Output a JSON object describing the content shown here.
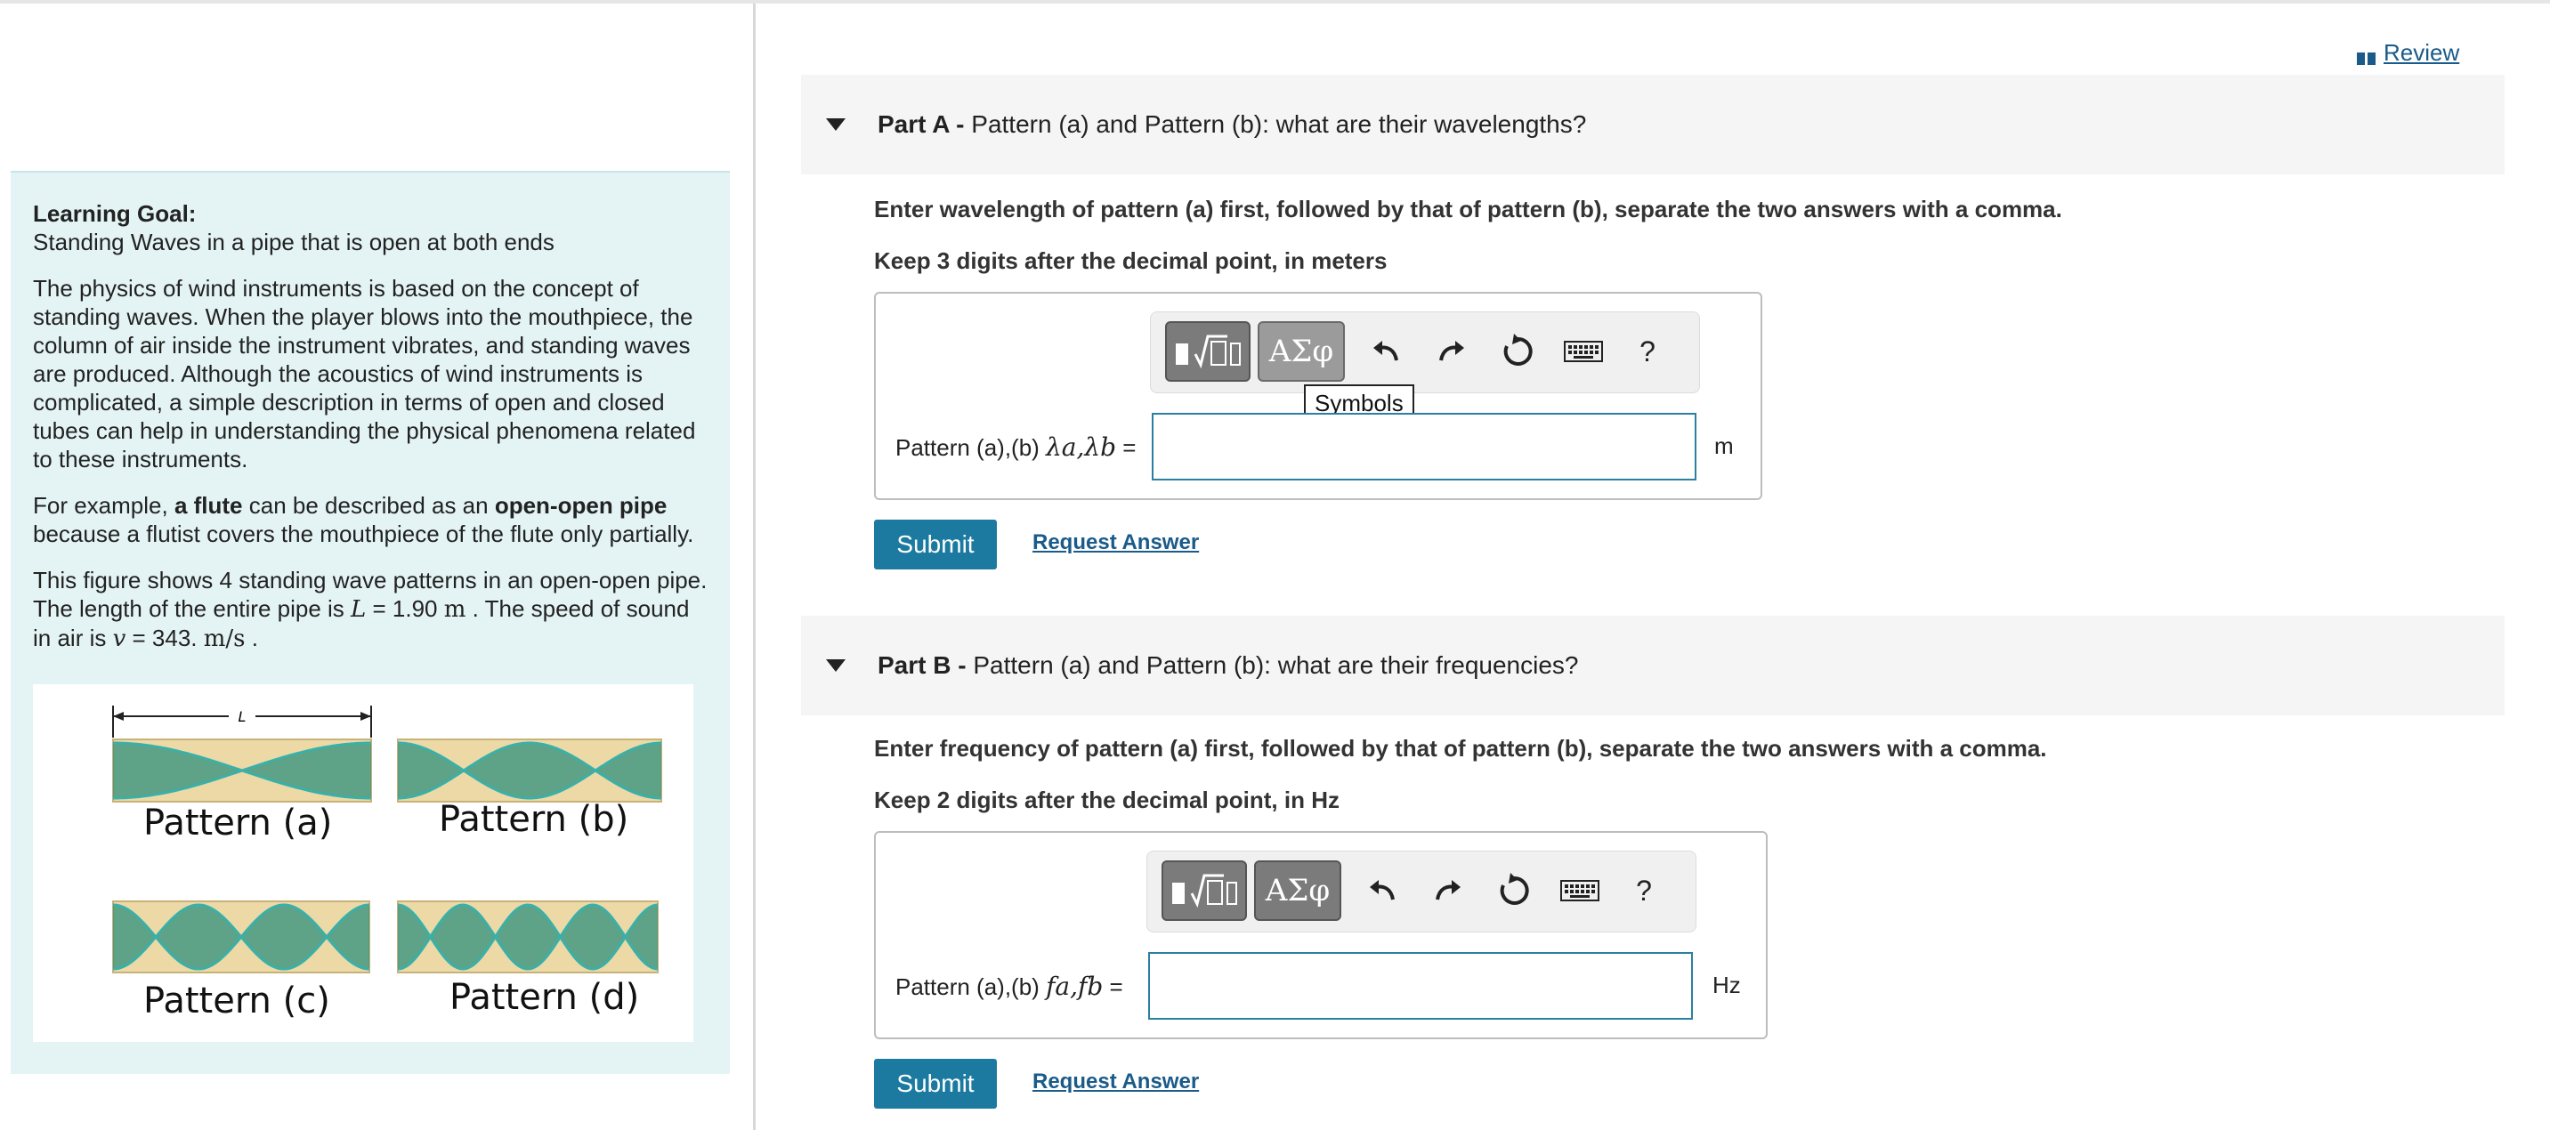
{
  "review": {
    "label": "Review"
  },
  "left": {
    "goal_title": "Learning Goal:",
    "goal_subtitle": "Standing Waves in a pipe that is open at both ends",
    "para1": "The physics of wind instruments is based on the concept of standing waves.  When the player blows into the mouthpiece, the column of air inside the instrument vibrates, and standing waves are produced. Although the acoustics of wind instruments is complicated, a simple description in terms of open and closed  tubes can help in understanding the physical phenomena related to these instruments.",
    "para2_prefix": "For example, ",
    "para2_b1": "a flute",
    "para2_mid": " can be described as an ",
    "para2_b2": "open-open pipe",
    "para2_suffix": " because a flutist covers the mouthpiece of the flute only partially.",
    "para3_a": "This figure shows 4 standing wave patterns in an open-open pipe. The length of the entire pipe is ",
    "L_sym": "L",
    "L_value": " = 1.90 ",
    "L_unit": "m",
    "para3_b": " . The speed of sound in air is ",
    "v_sym": "v",
    "v_value": " = 343. ",
    "v_unit": "m/s",
    "para3_c": " .",
    "figure": {
      "L_label": "L",
      "labels": [
        "Pattern (a)",
        "Pattern (b)",
        "Pattern (c)",
        "Pattern (d)"
      ],
      "colors": {
        "tube": "#ecd9a6",
        "wave": "#2f8f7c",
        "edge": "#3ab0a8"
      }
    }
  },
  "partA": {
    "header_bold": "Part A - ",
    "header_text": "Pattern (a) and Pattern (b): what are their wavelengths?",
    "instr1": "Enter wavelength of pattern (a) first, followed by that of pattern (b), separate the two answers with a comma.",
    "instr2": "Keep 3 digits after the decimal point, in meters",
    "label_prefix": "Pattern (a),(b)  ",
    "label_math": "λa,λb",
    "label_suffix": " =",
    "value": "",
    "unit": "m",
    "tooltip": "Symbols",
    "submit": "Submit",
    "request": "Request Answer"
  },
  "partB": {
    "header_bold": "Part B - ",
    "header_text": "Pattern (a) and Pattern (b): what are their frequencies?",
    "instr1": "Enter frequency of pattern (a) first, followed by that of pattern (b), separate the two answers with a comma.",
    "instr2": "Keep 2 digits after the decimal point, in Hz",
    "label_prefix": "Pattern (a),(b)  ",
    "label_math": "fa,fb",
    "label_suffix": " =",
    "value": "",
    "unit": "Hz",
    "submit": "Submit",
    "request": "Request Answer"
  },
  "toolbar": {
    "templates_icon": "templates-icon",
    "symbols_label": "ΑΣφ",
    "help": "?"
  }
}
